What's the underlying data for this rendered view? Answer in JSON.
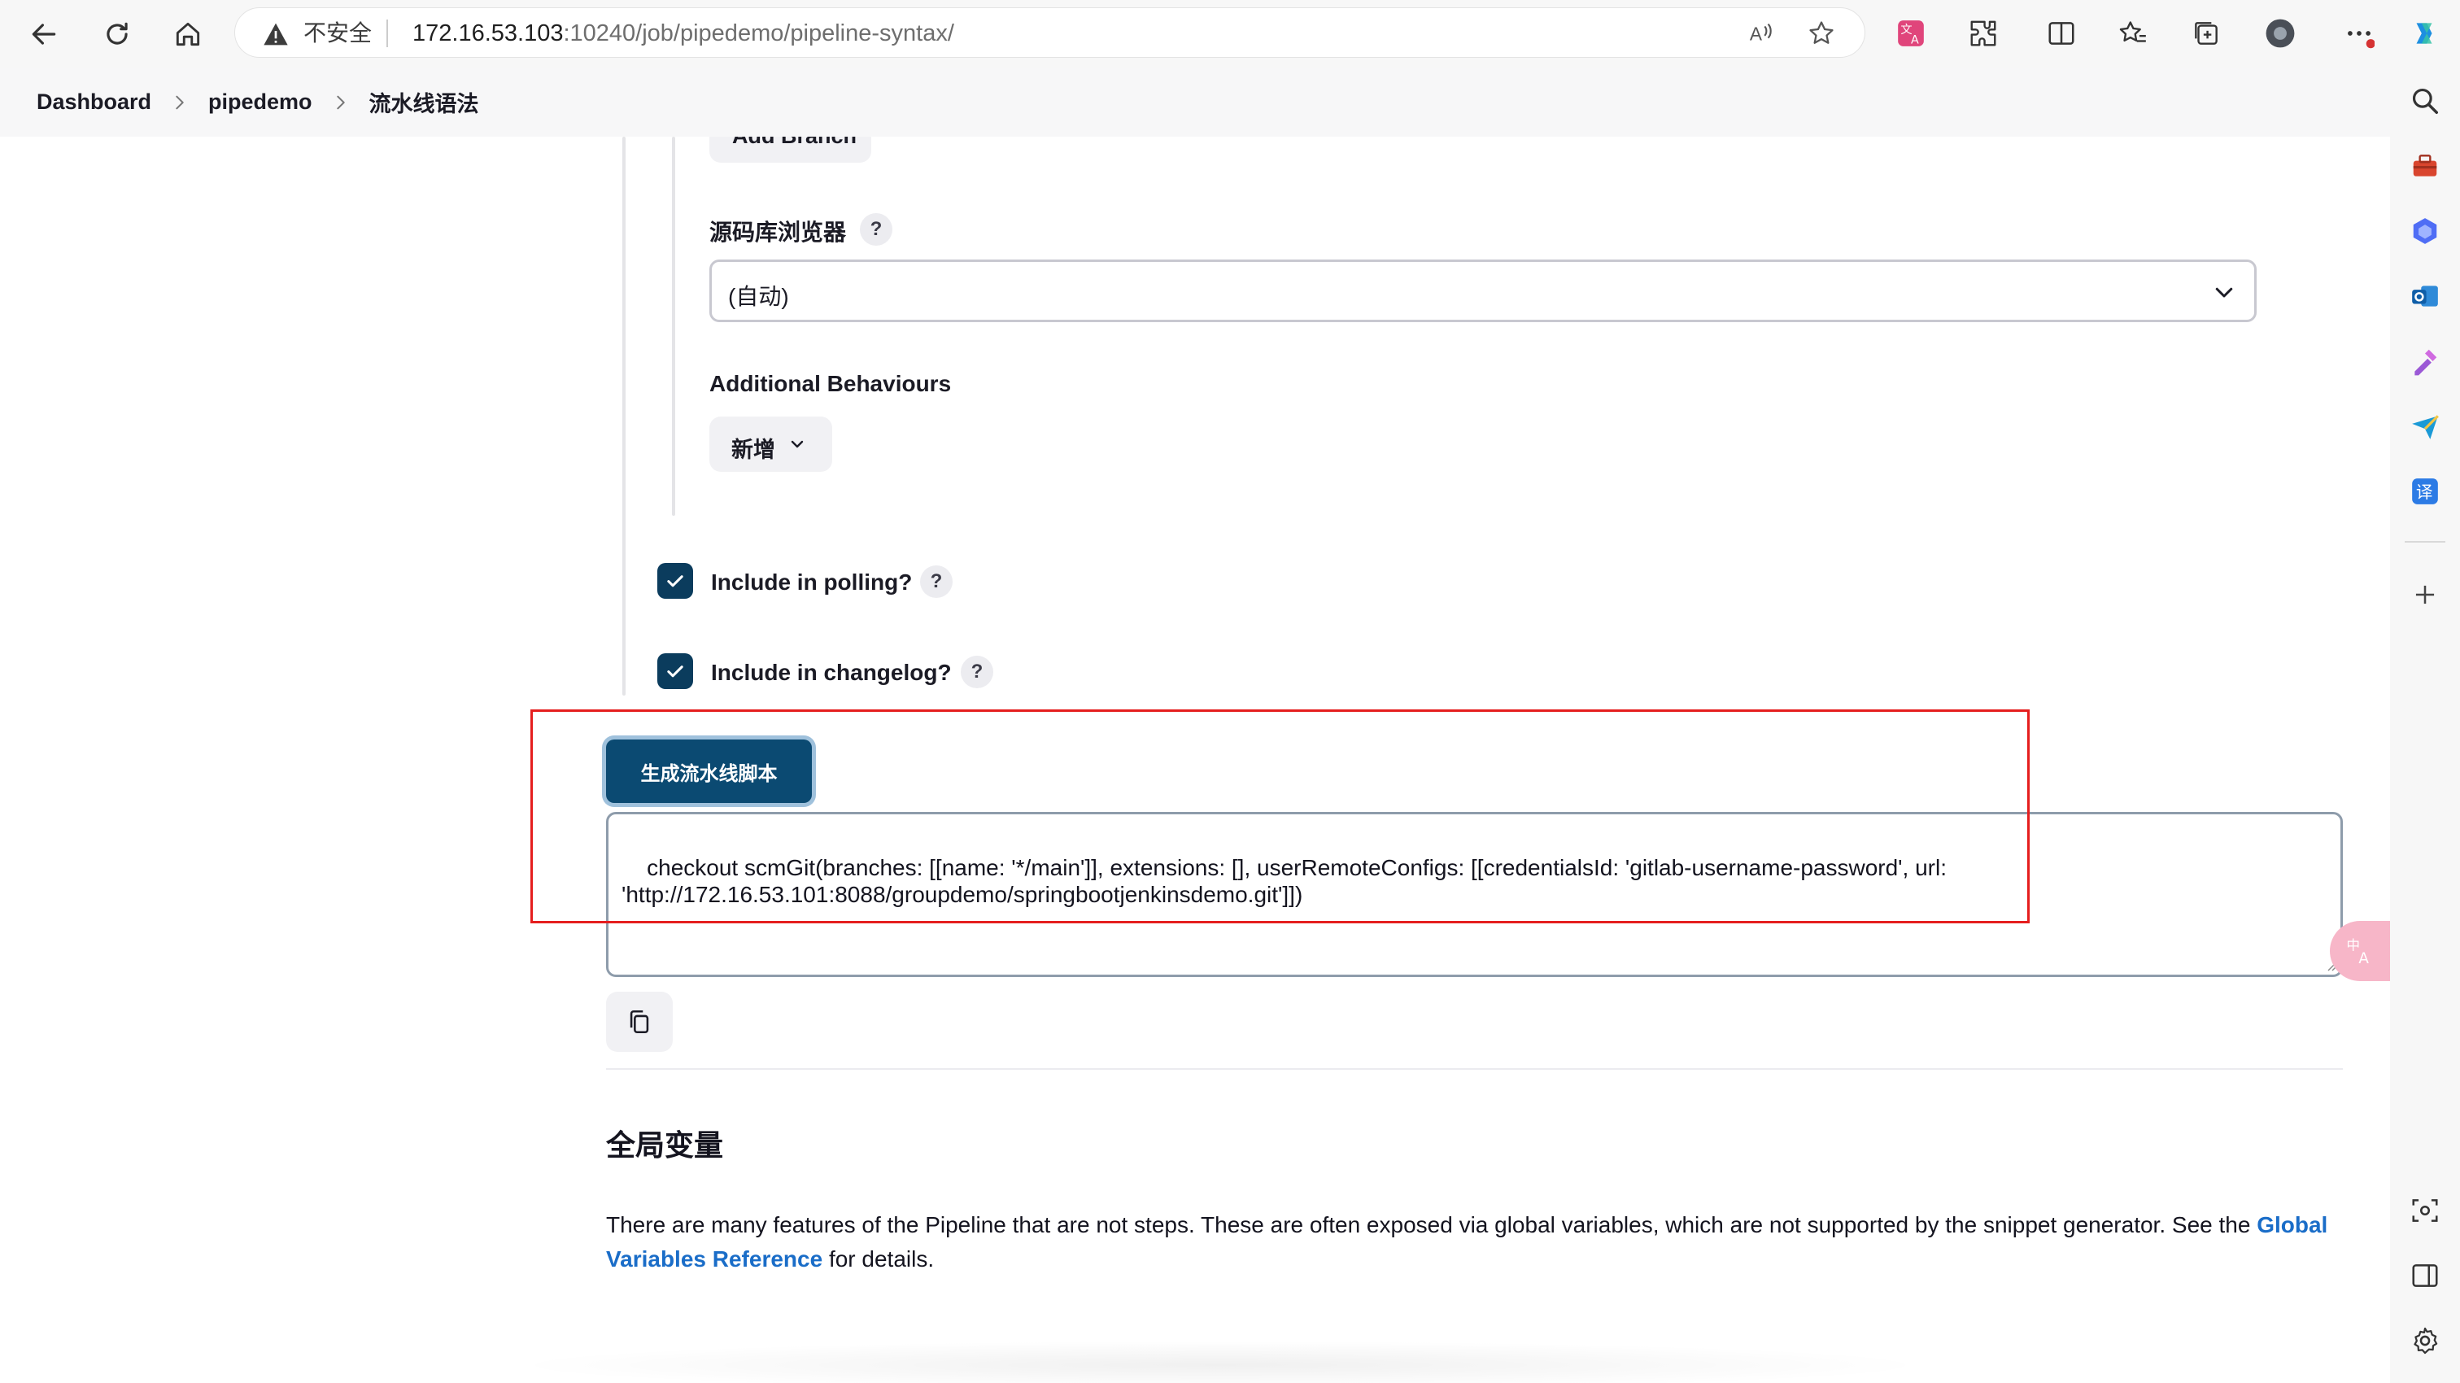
{
  "browser": {
    "url_security_label": "不安全",
    "url_host": "172.16.53.103",
    "url_path": ":10240/job/pipedemo/pipeline-syntax/"
  },
  "breadcrumb": {
    "items": [
      "Dashboard",
      "pipedemo",
      "流水线语法"
    ]
  },
  "form": {
    "add_branch_label": "Add Branch",
    "repo_browser": {
      "label": "源码库浏览器",
      "help": "?",
      "selected": "(自动)"
    },
    "additional_behaviours": {
      "label": "Additional Behaviours",
      "add_button": "新增"
    },
    "include_polling": {
      "label": "Include in polling?",
      "checked": true,
      "help": "?"
    },
    "include_changelog": {
      "label": "Include in changelog?",
      "checked": true,
      "help": "?"
    }
  },
  "generator": {
    "button_label": "生成流水线脚本",
    "script": "checkout scmGit(branches: [[name: '*/main']], extensions: [], userRemoteConfigs: [[credentialsId: 'gitlab-username-password', url: 'http://172.16.53.101:8088/groupdemo/springbootjenkinsdemo.git']])"
  },
  "global_vars": {
    "title": "全局变量",
    "text_before": "There are many features of the Pipeline that are not steps. These are often exposed via global variables, which are not supported by the snippet generator. See the ",
    "link_text": "Global Variables Reference",
    "text_after": " for details."
  },
  "colors": {
    "accent": "#0b4a72",
    "checkbox": "#0b3c5d",
    "link": "#1a6dc8",
    "highlight_box": "#e51e1e"
  }
}
